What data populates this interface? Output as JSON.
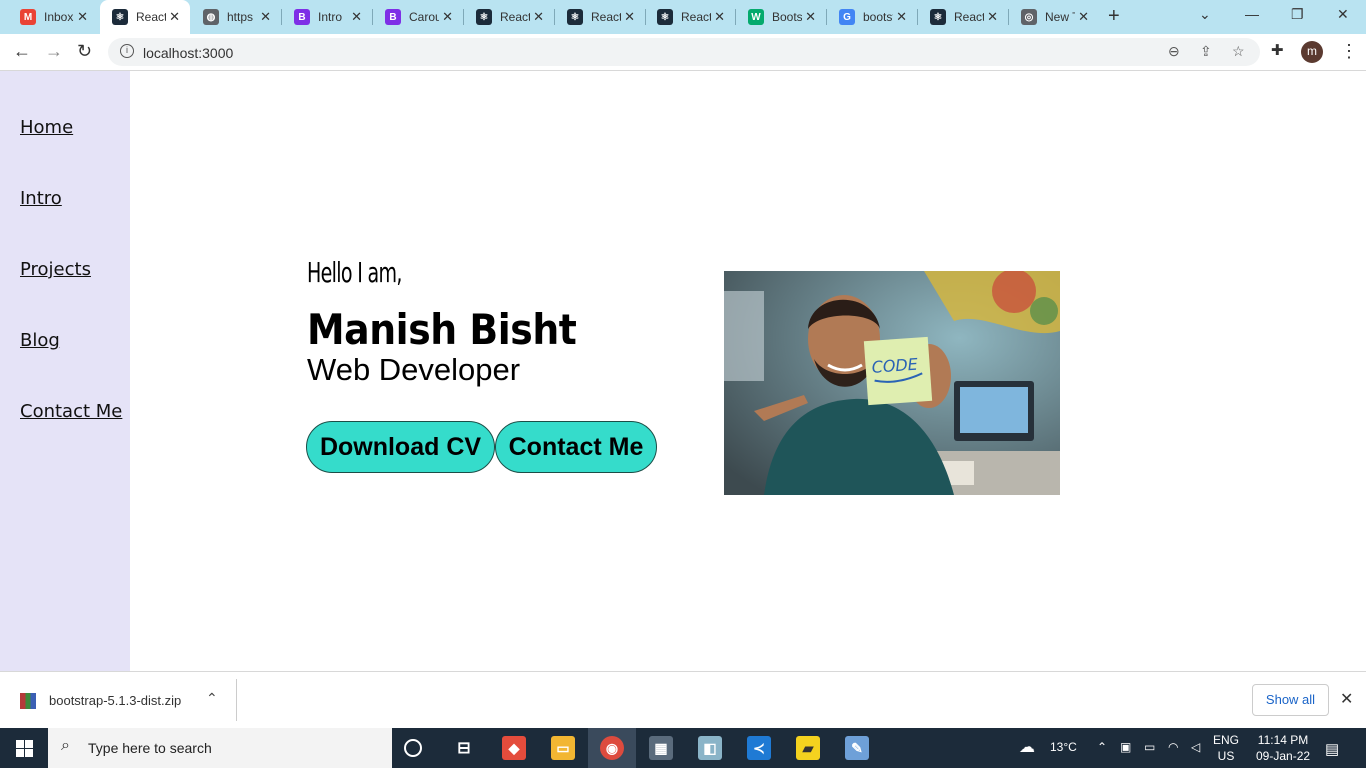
{
  "browser": {
    "tabs": [
      {
        "title": "Inbox",
        "favicon": "gmail-icon",
        "color": "#ea4335",
        "glyph": "M"
      },
      {
        "title": "React App",
        "favicon": "react-icon",
        "color": "#1c2b3a",
        "glyph": "⚛"
      },
      {
        "title": "https",
        "favicon": "globe-icon",
        "color": "#5f6368",
        "glyph": "◍"
      },
      {
        "title": "Intro",
        "favicon": "bootstrap-icon",
        "color": "#7e2fe6",
        "glyph": "B"
      },
      {
        "title": "Carousel",
        "favicon": "bootstrap-icon",
        "color": "#7e2fe6",
        "glyph": "B"
      },
      {
        "title": "React",
        "favicon": "react-icon",
        "color": "#1c2b3a",
        "glyph": "⚛"
      },
      {
        "title": "React",
        "favicon": "react-icon",
        "color": "#1c2b3a",
        "glyph": "⚛"
      },
      {
        "title": "React",
        "favicon": "react-icon",
        "color": "#1c2b3a",
        "glyph": "⚛"
      },
      {
        "title": "Bootstrap",
        "favicon": "w3schools-icon",
        "color": "#04aa6d",
        "glyph": "W"
      },
      {
        "title": "bootstrap",
        "favicon": "google-icon",
        "color": "#4285f4",
        "glyph": "G"
      },
      {
        "title": "React",
        "favicon": "react-icon",
        "color": "#1c2b3a",
        "glyph": "⚛"
      },
      {
        "title": "New Tab",
        "favicon": "chrome-icon",
        "color": "#5f6368",
        "glyph": "◎"
      }
    ],
    "active_tab": 1,
    "url": "localhost:3000",
    "profile_initial": "m"
  },
  "sidebar": {
    "items": [
      {
        "label": "Home"
      },
      {
        "label": "Intro"
      },
      {
        "label": "Projects"
      },
      {
        "label": "Blog"
      },
      {
        "label": "Contact Me"
      }
    ]
  },
  "hero": {
    "greeting": "Hello I am,",
    "name": "Manish Bisht",
    "role": "Web Developer",
    "download_cv": "Download CV",
    "contact_me": "Contact Me",
    "photo_note": "CODE"
  },
  "download_bar": {
    "filename": "bootstrap-5.1.3-dist.zip",
    "show_all": "Show all"
  },
  "taskbar": {
    "search_placeholder": "Type here to search",
    "weather": "13°C",
    "language": "ENG",
    "region": "US",
    "time": "11:14 PM",
    "date": "09-Jan-22"
  },
  "colors": {
    "sidebar_bg": "#e5e3f7",
    "button_bg": "#35dccb",
    "tabbar_bg": "#b9e3f1"
  }
}
